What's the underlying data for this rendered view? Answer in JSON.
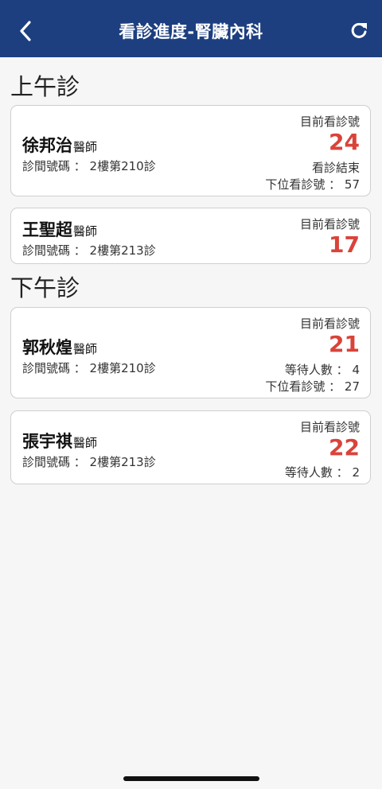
{
  "header": {
    "title": "看診進度-腎臟內科",
    "back_icon": "chevron-left-icon",
    "refresh_icon": "refresh-icon",
    "background": "#1d3f80"
  },
  "colors": {
    "accent_number": "#d9433a"
  },
  "sections": [
    {
      "title": "上午診",
      "cards": [
        {
          "doctor": "徐邦治",
          "doctor_suffix": "醫師",
          "room": "診間號碼 ： 2樓第210診",
          "current_label": "目前看診號",
          "current_number": "24",
          "status_lines": [
            "看診結束",
            "下位看診號 ： 57"
          ]
        },
        {
          "doctor": "王聖超",
          "doctor_suffix": "醫師",
          "room": "診間號碼 ： 2樓第213診",
          "current_label": "目前看診號",
          "current_number": "17",
          "status_lines": []
        }
      ]
    },
    {
      "title": "下午診",
      "cards": [
        {
          "doctor": "郭秋煌",
          "doctor_suffix": "醫師",
          "room": "診間號碼 ： 2樓第210診",
          "current_label": "目前看診號",
          "current_number": "21",
          "status_lines": [
            "等待人數 ： 4",
            "下位看診號 ： 27"
          ]
        },
        {
          "doctor": "張宇祺",
          "doctor_suffix": "醫師",
          "room": "診間號碼 ： 2樓第213診",
          "current_label": "目前看診號",
          "current_number": "22",
          "status_lines": [
            "等待人數 ： 2"
          ]
        }
      ]
    }
  ]
}
